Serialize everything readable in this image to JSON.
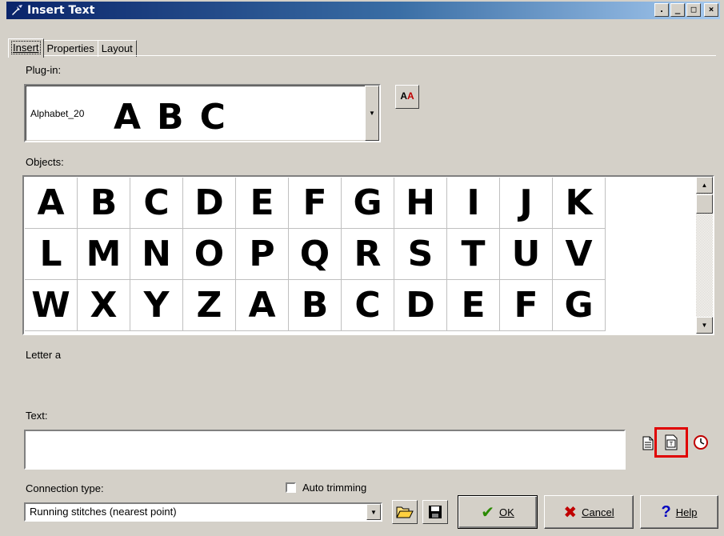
{
  "window": {
    "title": "Insert Text",
    "controls": [
      "minimize",
      "restore",
      "maximize",
      "close"
    ]
  },
  "tabs": [
    {
      "label": "Insert",
      "active": true
    },
    {
      "label": "Properties",
      "active": false
    },
    {
      "label": "Layout",
      "active": false
    }
  ],
  "plugin": {
    "label": "Plug-in:",
    "selected": "Alphabet_20",
    "preview": "ABC"
  },
  "objects": {
    "label": "Objects:",
    "letters": [
      "A",
      "B",
      "C",
      "D",
      "E",
      "F",
      "G",
      "H",
      "I",
      "J",
      "K",
      "L",
      "M",
      "N",
      "O",
      "P",
      "Q",
      "R",
      "S",
      "T",
      "U",
      "V",
      "W",
      "X",
      "Y",
      "Z",
      "A",
      "B",
      "C",
      "D",
      "E",
      "F",
      "G"
    ],
    "status": "Letter a"
  },
  "text": {
    "label": "Text:",
    "value": ""
  },
  "connection": {
    "label": "Connection type:",
    "selected": "Running stitches (nearest point)"
  },
  "auto_trimming": {
    "label": "Auto trimming",
    "checked": false
  },
  "buttons": {
    "ok": "OK",
    "cancel": "Cancel",
    "help": "Help"
  },
  "colors": {
    "title_start": "#0a246a",
    "title_end": "#a6caf0",
    "face": "#d4d0c8",
    "highlight": "#e00000",
    "ok_check": "#2a8a00",
    "cancel_x": "#c00000",
    "help_mark": "#0000c0"
  }
}
